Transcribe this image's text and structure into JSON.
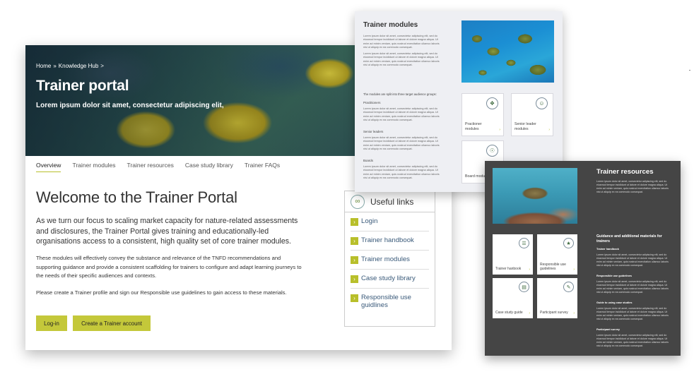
{
  "portal": {
    "breadcrumb": [
      "Home",
      "»",
      "Knowledge Hub",
      ">"
    ],
    "title": "Trainer portal",
    "subtitle": "Lorem ipsum dolor sit amet, consectetur adipiscing elit,",
    "tabs": [
      "Overview",
      "Trainer modules",
      "Trainer resources",
      "Case study library",
      "Trainer FAQs"
    ],
    "welcome": "Welcome to the Trainer Portal",
    "lead": "As we turn our focus to scaling market capacity for nature-related assessments and disclosures, the Trainer Portal gives training and educationally-led organisations access to a consistent, high quality set of core trainer modules.",
    "body1": "These modules will effectively convey the substance and relevance of the TNFD recommendations and supporting guidance and provide a consistent scaffolding for trainers to configure and adapt learning journeys to the needs of their specific audiences and contexts.",
    "body2": "Please create a Trainer profile and sign our Responsible use guidelines to gain access to these materials.",
    "login_label": "Log-in",
    "create_label": "Create a Trainer account",
    "useful_links": {
      "title": "Useful links",
      "items": [
        "Login",
        "Trainer handbook",
        "Trainer modules",
        "Case study library",
        "Responsible use guidlines"
      ]
    }
  },
  "modules": {
    "title": "Trainer modules",
    "para1": "Lorem ipsum dolor sit amet, consectetur adipiscing elit, sed do eiusmod tempor incididunt ut labore et dolore magna aliqua. Ut enim ad minim veniam, quis nostrud exercitation ullamco laboris nisi ut aliquip ex ea commodo consequat.",
    "para2": "Lorem ipsum dolor sit amet, consectetur adipiscing elit, sed do eiusmod tempor incididunt ut labore et dolore magna aliqua. Ut enim ad minim veniam, quis nostrud exercitation ullamco laboris nisi ut aliquip ex ea commodo consequat.",
    "intro": "The modules are split into three target audience groups:",
    "groups": [
      {
        "heading": "Practitioners",
        "text": "Lorem ipsum dolor sit amet, consectetur adipiscing elit, sed do eiusmod tempor incididunt ut labore et dolore magna aliqua. Ut enim ad minim veniam, quis nostrud exercitation ullamco laboris nisi ut aliquip ex ea commodo consequat."
      },
      {
        "heading": "Senior leaders",
        "text": "Lorem ipsum dolor sit amet, consectetur adipiscing elit, sed do eiusmod tempor incididunt ut labore et dolore magna aliqua. Ut enim ad minim veniam, quis nostrud exercitation ullamco laboris nisi ut aliquip ex ea commodo consequat."
      },
      {
        "heading": "Boards",
        "text": "Lorem ipsum dolor sit amet, consectetur adipiscing elit, sed do eiusmod tempor incididunt ut labore et dolore magna aliqua. Ut enim ad minim veniam, quis nostrud exercitation ullamco laboris nisi ut aliquip ex ea commodo consequat."
      }
    ],
    "tiles": [
      {
        "label": "Practioner modules",
        "icon": "layers-icon"
      },
      {
        "label": "Senior leader modules",
        "icon": "leader-icon"
      },
      {
        "label": "Board modules",
        "icon": "group-icon"
      }
    ]
  },
  "resources": {
    "title": "Trainer resources",
    "para1": "Lorem ipsum dolor sit amet, consectetur adipiscing elit, sed do eiusmod tempor incididunt ut labore et dolore magna aliqua. Ut enim ad minim veniam, quis nostrud exercitation ullamco laboris nisi ut aliquip ex ea commodo consequat.",
    "guidance_heading": "Guidance and additional materials for trainers",
    "sections": [
      {
        "heading": "Trainer handbook",
        "text": "Lorem ipsum dolor sit amet, consectetur adipiscing elit, sed do eiusmod tempor incididunt ut labore et dolore magna aliqua. Ut enim ad minim veniam, quis nostrud exercitation ullamco laboris nisi ut aliquip ex ea commodo consequat."
      },
      {
        "heading": "Responsible use guidelines",
        "text": "Lorem ipsum dolor sit amet, consectetur adipiscing elit, sed do eiusmod tempor incididunt ut labore et dolore magna aliqua. Ut enim ad minim veniam, quis nostrud exercitation ullamco laboris nisi ut aliquip ex ea commodo consequat."
      },
      {
        "heading": "Guide to using case studies",
        "text": "Lorem ipsum dolor sit amet, consectetur adipiscing elit, sed do eiusmod tempor incididunt ut labore et dolore magna aliqua. Ut enim ad minim veniam, quis nostrud exercitation ullamco laboris nisi ut aliquip ex ea commodo consequat."
      },
      {
        "heading": "Participant survey",
        "text": "Lorem ipsum dolor sit amet, consectetur adipiscing elit, sed do eiusmod tempor incididunt ut labore et dolore magna aliqua. Ut enim ad minim veniam, quis nostrud exercitation ullamco laboris nisi ut aliquip ex ea commodo consequat."
      }
    ],
    "tiles": [
      {
        "label": "Trainer hanbook",
        "icon": "document-icon"
      },
      {
        "label": "Responsible use guidelines",
        "icon": "network-icon"
      },
      {
        "label": "Case study guide",
        "icon": "file-icon"
      },
      {
        "label": "Participant survey",
        "icon": "edit-icon"
      }
    ]
  },
  "colors": {
    "accent": "#c4c83a",
    "link_text": "#3a5a7a",
    "resources_bg": "#454545",
    "modules_bg": "#eeeff3"
  }
}
